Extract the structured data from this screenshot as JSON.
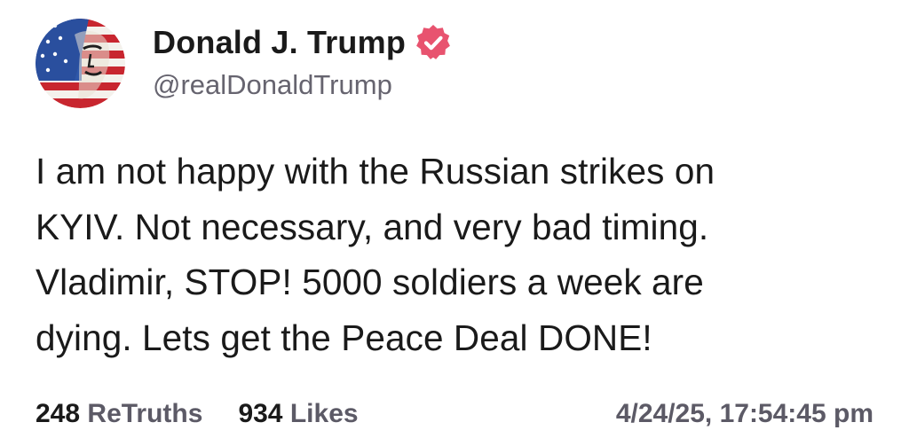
{
  "post": {
    "author": {
      "display_name": "Donald J. Trump",
      "handle": "@realDonaldTrump",
      "verified_color": "#e8536f",
      "avatar_icon": "flag-portrait-avatar"
    },
    "text": "I am not happy with the Russian strikes on\nKYIV. Not necessary, and very bad timing.\nVladimir, STOP! 5000 soldiers a week are\ndying. Lets get the Peace Deal DONE!",
    "stats": {
      "retruths_count": "248",
      "retruths_label": "ReTruths",
      "likes_count": "934",
      "likes_label": "Likes"
    },
    "timestamp": "4/24/25, 17:54:45 pm"
  }
}
